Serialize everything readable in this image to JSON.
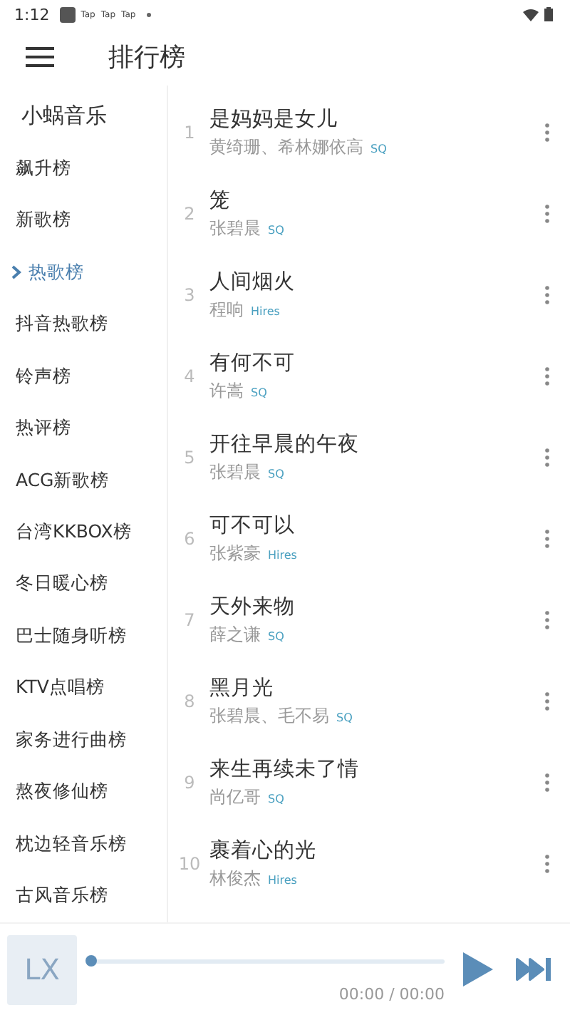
{
  "status_bar": {
    "time": "1:12",
    "notifications": [
      "Tap",
      "Tap",
      "Tap"
    ]
  },
  "header": {
    "title": "排行榜"
  },
  "sidebar": {
    "source": "小蜗音乐",
    "items": [
      {
        "label": "飙升榜",
        "selected": false
      },
      {
        "label": "新歌榜",
        "selected": false
      },
      {
        "label": "热歌榜",
        "selected": true
      },
      {
        "label": "抖音热歌榜",
        "selected": false
      },
      {
        "label": "铃声榜",
        "selected": false
      },
      {
        "label": "热评榜",
        "selected": false
      },
      {
        "label": "ACG新歌榜",
        "selected": false
      },
      {
        "label": "台湾KKBOX榜",
        "selected": false
      },
      {
        "label": "冬日暖心榜",
        "selected": false
      },
      {
        "label": "巴士随身听榜",
        "selected": false
      },
      {
        "label": "KTV点唱榜",
        "selected": false
      },
      {
        "label": "家务进行曲榜",
        "selected": false
      },
      {
        "label": "熬夜修仙榜",
        "selected": false
      },
      {
        "label": "枕边轻音乐榜",
        "selected": false
      },
      {
        "label": "古风音乐榜",
        "selected": false
      }
    ]
  },
  "songs": [
    {
      "rank": "1",
      "title": "是妈妈是女儿",
      "artist": "黄绮珊、希林娜依高",
      "quality": "SQ"
    },
    {
      "rank": "2",
      "title": "笼",
      "artist": "张碧晨",
      "quality": "SQ"
    },
    {
      "rank": "3",
      "title": "人间烟火",
      "artist": "程响",
      "quality": "Hires"
    },
    {
      "rank": "4",
      "title": "有何不可",
      "artist": "许嵩",
      "quality": "SQ"
    },
    {
      "rank": "5",
      "title": "开往早晨的午夜",
      "artist": "张碧晨",
      "quality": "SQ"
    },
    {
      "rank": "6",
      "title": "可不可以",
      "artist": "张紫豪",
      "quality": "Hires"
    },
    {
      "rank": "7",
      "title": "天外来物",
      "artist": "薛之谦",
      "quality": "SQ"
    },
    {
      "rank": "8",
      "title": "黑月光",
      "artist": "张碧晨、毛不易",
      "quality": "SQ"
    },
    {
      "rank": "9",
      "title": "来生再续未了情",
      "artist": "尚亿哥",
      "quality": "SQ"
    },
    {
      "rank": "10",
      "title": "裹着心的光",
      "artist": "林俊杰",
      "quality": "Hires"
    }
  ],
  "player": {
    "cover": "LX",
    "progress": {
      "level": 0
    },
    "time": "00:00 / 00:00"
  }
}
